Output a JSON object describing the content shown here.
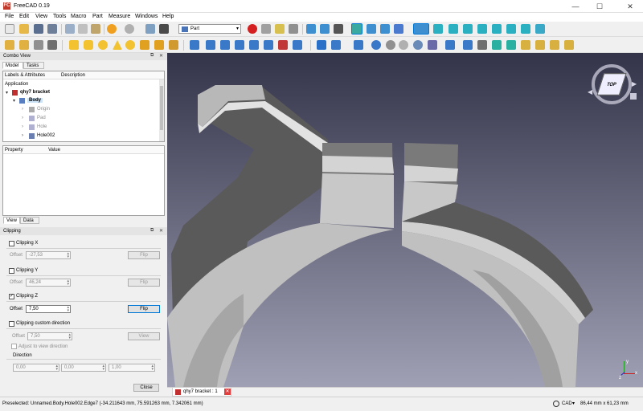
{
  "window": {
    "title": "FreeCAD 0.19",
    "app_icon_label": "FC",
    "min_glyph": "—",
    "max_glyph": "☐",
    "close_glyph": "✕"
  },
  "menu": [
    "File",
    "Edit",
    "View",
    "Tools",
    "Macro",
    "Part",
    "Measure",
    "Windows",
    "Help"
  ],
  "toolbar": {
    "workbench": "Part"
  },
  "combo_view": {
    "title": "Combo View",
    "tabs": [
      "Model",
      "Tasks"
    ],
    "tree_headers": [
      "Labels & Attributes",
      "Description"
    ],
    "tree": {
      "section": "Application",
      "document": "qhy7 bracket",
      "body": "Body",
      "children": [
        "Origin",
        "Pad",
        "Hole",
        "Hole002"
      ]
    },
    "property_headers": [
      "Property",
      "Value"
    ],
    "bottom_tabs": [
      "View",
      "Data"
    ]
  },
  "clipping": {
    "title": "Clipping",
    "x": {
      "label": "Clipping X",
      "checked": false,
      "offset_label": "Offset",
      "offset": "-27,53",
      "flip": "Flip"
    },
    "y": {
      "label": "Clipping Y",
      "checked": false,
      "offset_label": "Offset",
      "offset": "46,24",
      "flip": "Flip"
    },
    "z": {
      "label": "Clipping Z",
      "checked": true,
      "offset_label": "Offset",
      "offset": "7,50",
      "flip": "Flip"
    },
    "custom": {
      "label": "Clipping custom direction",
      "checked": false,
      "offset_label": "Offset",
      "offset": "7,50",
      "view": "View",
      "adjust": "Adjust to view direction"
    },
    "direction": {
      "label": "Direction",
      "values": [
        "0,00",
        "0,00",
        "1,00"
      ]
    },
    "close": "Close"
  },
  "navcube": {
    "face": "TOP"
  },
  "axis": {
    "x": "x",
    "y": "y",
    "z": "z"
  },
  "document_tab": {
    "label": "qhy7 bracket : 1"
  },
  "status": {
    "preselected": "Preselected: Unnamed.Body.Hole002.Edge7 (-34.211643 mm, 75.591263 mm, 7.342061 mm)",
    "nav_style": "CAD",
    "dimensions": "86,44 mm x 61,23 mm"
  },
  "colors": {
    "viewport_top": "#333349",
    "viewport_bottom": "#a0a0b5",
    "part_face": "#c0c0c0",
    "part_dark": "#5a5a5a",
    "selection": "#0078d7"
  }
}
